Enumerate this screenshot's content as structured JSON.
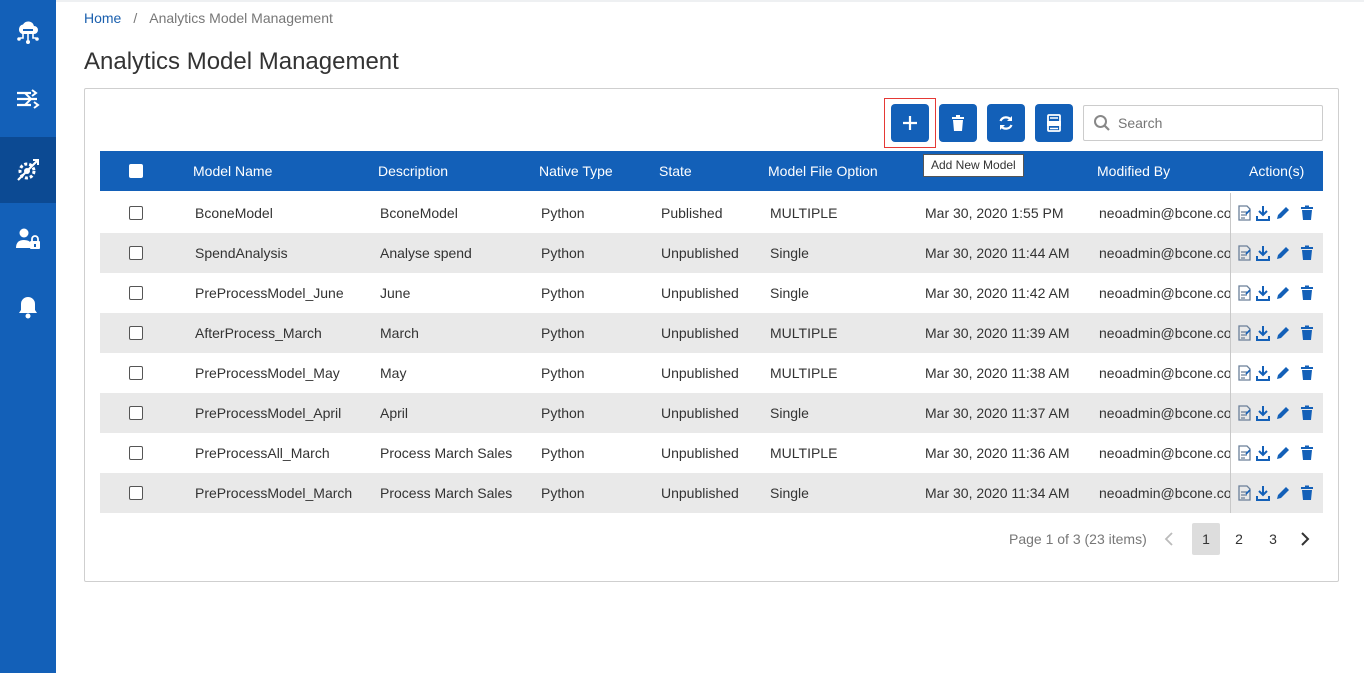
{
  "breadcrumb": {
    "home": "Home",
    "separator": "/",
    "current": "Analytics Model Management"
  },
  "page": {
    "title": "Analytics Model Management"
  },
  "sidebar": {
    "items": [
      {
        "icon": "cloud-network-icon"
      },
      {
        "icon": "pipeline-sliders-icon"
      },
      {
        "icon": "model-gear-icon",
        "active": true
      },
      {
        "icon": "user-lock-icon"
      },
      {
        "icon": "bell-icon"
      }
    ]
  },
  "toolbar": {
    "add_icon": "plus-icon",
    "delete_icon": "trash-icon",
    "refresh_icon": "refresh-icon",
    "export_icon": "xlsx-icon",
    "tooltip": "Add New Model",
    "search_placeholder": "Search"
  },
  "table": {
    "columns": [
      "Model Name",
      "Description",
      "Native Type",
      "State",
      "Model File Option",
      "Modified By",
      "Action(s)"
    ],
    "rows": [
      {
        "name": "BconeModel",
        "description": "BconeModel",
        "type": "Python",
        "state": "Published",
        "file_option": "MULTIPLE",
        "modified_on": "Mar 30, 2020 1:55 PM",
        "modified_by": "neoadmin@bcone.com"
      },
      {
        "name": "SpendAnalysis",
        "description": "Analyse spend",
        "type": "Python",
        "state": "Unpublished",
        "file_option": "Single",
        "modified_on": "Mar 30, 2020 11:44 AM",
        "modified_by": "neoadmin@bcone.com"
      },
      {
        "name": "PreProcessModel_June",
        "description": "June",
        "type": "Python",
        "state": "Unpublished",
        "file_option": "Single",
        "modified_on": "Mar 30, 2020 11:42 AM",
        "modified_by": "neoadmin@bcone.com"
      },
      {
        "name": "AfterProcess_March",
        "description": "March",
        "type": "Python",
        "state": "Unpublished",
        "file_option": "MULTIPLE",
        "modified_on": "Mar 30, 2020 11:39 AM",
        "modified_by": "neoadmin@bcone.com"
      },
      {
        "name": "PreProcessModel_May",
        "description": "May",
        "type": "Python",
        "state": "Unpublished",
        "file_option": "MULTIPLE",
        "modified_on": "Mar 30, 2020 11:38 AM",
        "modified_by": "neoadmin@bcone.com"
      },
      {
        "name": "PreProcessModel_April",
        "description": "April",
        "type": "Python",
        "state": "Unpublished",
        "file_option": "Single",
        "modified_on": "Mar 30, 2020 11:37 AM",
        "modified_by": "neoadmin@bcone.com"
      },
      {
        "name": "PreProcessAll_March",
        "description": "Process March Sales",
        "type": "Python",
        "state": "Unpublished",
        "file_option": "MULTIPLE",
        "modified_on": "Mar 30, 2020 11:36 AM",
        "modified_by": "neoadmin@bcone.com"
      },
      {
        "name": "PreProcessModel_March",
        "description": "Process March Sales",
        "type": "Python",
        "state": "Unpublished",
        "file_option": "Single",
        "modified_on": "Mar 30, 2020 11:34 AM",
        "modified_by": "neoadmin@bcone.com"
      }
    ],
    "row_actions": [
      "log-icon",
      "download-icon",
      "edit-icon",
      "trash-icon"
    ]
  },
  "pagination": {
    "info": "Page 1 of 3 (23 items)",
    "pages": [
      "1",
      "2",
      "3"
    ],
    "current": "1"
  },
  "colors": {
    "primary": "#1360b8",
    "sidebar_active": "#0c4a93",
    "row_alt": "#e9e9e9",
    "focus": "#e53935"
  }
}
